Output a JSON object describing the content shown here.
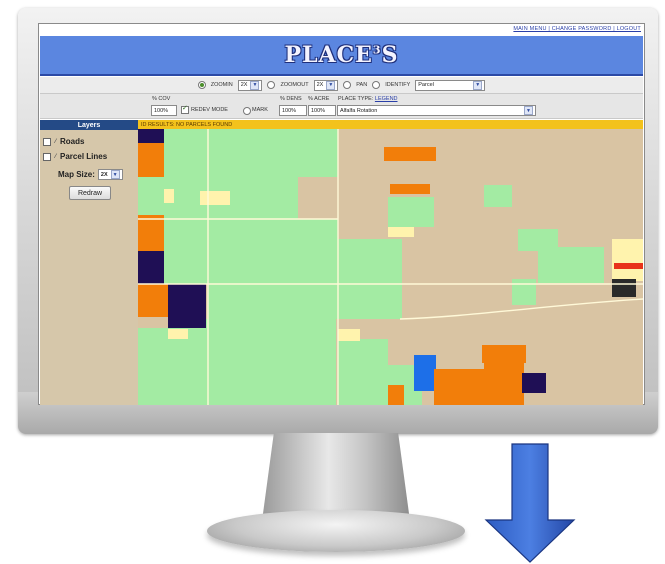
{
  "app": {
    "title": "PLACE",
    "title_sup": "3",
    "title_suffix": "S",
    "colors": {
      "banner": "#5b86e0",
      "results_bar": "#f3c21c",
      "sidebar": "#d6c7aa",
      "layers_header": "#244a86"
    }
  },
  "topnav": {
    "text": "MAIN MENU | CHANGE PASSWORD | LOGOUT"
  },
  "toolbar": {
    "zoomin_label": "ZOOMIN",
    "zoomin_value": "2X",
    "zoomout_label": "ZOOMOUT",
    "zoomout_value": "2X",
    "pan_label": "PAN",
    "identify_label": "IDENTIFY",
    "identify_value": "Parcel",
    "selected_tool": "zoomin"
  },
  "options": {
    "cov_label": "% COV",
    "cov_value": "100%",
    "redev_label": "REDEV MODE",
    "mark_label": "MARK",
    "dens_label": "% DENS",
    "dens_value": "100%",
    "acre_label": "% ACRE",
    "acre_value": "100%",
    "place_type_label": "PLACE TYPE:",
    "legend_link": "LEGEND",
    "place_type_value": "Alfalfa Rotation"
  },
  "results": {
    "text": "ID RESULTS: NO PARCELS FOUND"
  },
  "sidebar": {
    "header": "Layers",
    "layers": [
      {
        "label": "Roads"
      },
      {
        "label": "Parcel Lines"
      }
    ],
    "map_size_label": "Map Size:",
    "map_size_value": "2X",
    "redraw_label": "Redraw"
  },
  "map": {
    "colors": {
      "tan": "#d9c4a3",
      "green": "#a3eba3",
      "orange": "#f27e0a",
      "navy": "#1f0f55",
      "cream": "#fff3ad",
      "blue": "#1d6fe8",
      "red": "#e8321a",
      "dark": "#2a2a2a"
    }
  }
}
